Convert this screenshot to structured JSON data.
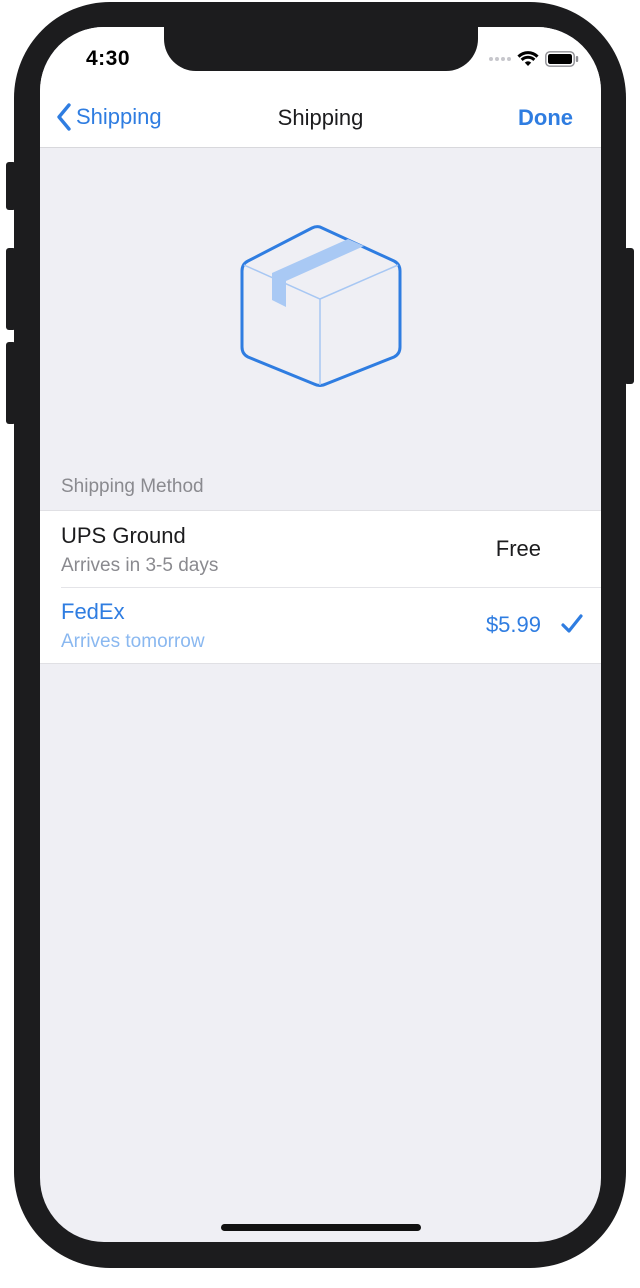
{
  "status_bar": {
    "time": "4:30",
    "icons": [
      "cellular-signal-icon",
      "wifi-icon",
      "battery-icon"
    ]
  },
  "navbar": {
    "back_label": "Shipping",
    "title": "Shipping",
    "done_label": "Done"
  },
  "hero": {
    "icon": "package-box-icon"
  },
  "section": {
    "header": "Shipping Method"
  },
  "methods": [
    {
      "title": "UPS Ground",
      "subtitle": "Arrives in 3-5 days",
      "price": "Free",
      "selected": false
    },
    {
      "title": "FedEx",
      "subtitle": "Arrives tomorrow",
      "price": "$5.99",
      "selected": true
    }
  ],
  "colors": {
    "accent": "#2f7de1",
    "background": "#efeff4",
    "secondary_text": "#8a8a8f"
  }
}
